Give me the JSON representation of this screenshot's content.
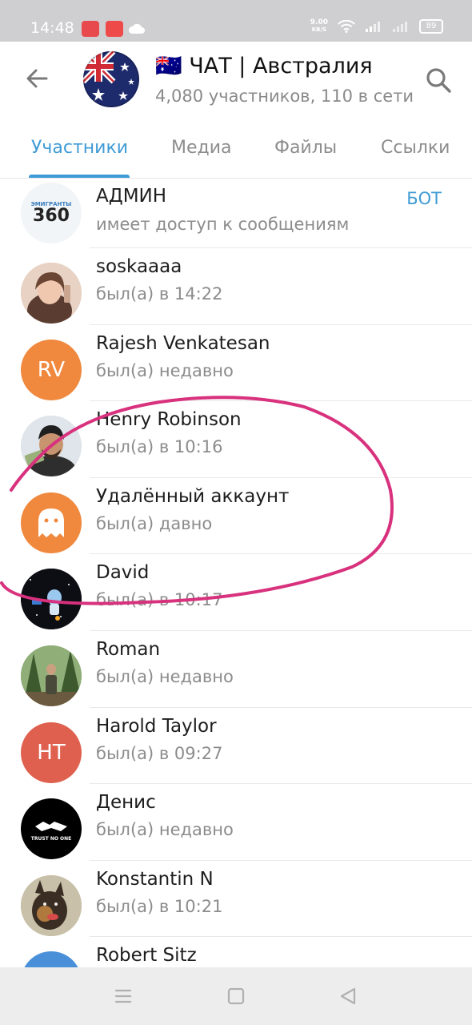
{
  "status_bar": {
    "time": "14:48",
    "speed_value": "9.00",
    "speed_unit": "KB/S",
    "battery": "89"
  },
  "header": {
    "flag": "🇦🇺",
    "title": "ЧАТ | Австралия",
    "subtitle": "4,080 участников, 110 в сети"
  },
  "tabs": [
    {
      "label": "Участники",
      "active": true
    },
    {
      "label": "Медиа",
      "active": false
    },
    {
      "label": "Файлы",
      "active": false
    },
    {
      "label": "Ссылки",
      "active": false
    }
  ],
  "admin_logo": {
    "line1": "ЭМИГРАНТЫ",
    "line2": "360"
  },
  "members": [
    {
      "name": "АДМИН",
      "status": "имеет доступ к сообщениям",
      "role": "БОТ",
      "avatar_type": "logo"
    },
    {
      "name": "soskaaaa",
      "status": "был(а) в 14:22",
      "avatar_type": "photo-woman"
    },
    {
      "name": "Rajesh Venkatesan",
      "status": "был(а) недавно",
      "initials": "RV",
      "avatar_color": "#f0883e",
      "avatar_type": "initials"
    },
    {
      "name": "Henry Robinson",
      "status": "был(а) в 10:16",
      "avatar_type": "photo-man"
    },
    {
      "name": "Удалённый аккаунт",
      "status": "был(а) давно",
      "avatar_color": "#f0883e",
      "avatar_type": "ghost-icon"
    },
    {
      "name": "David",
      "status": "был(а) в 10:17",
      "avatar_type": "photo-space"
    },
    {
      "name": "Roman",
      "status": "был(а) недавно",
      "avatar_type": "photo-forest"
    },
    {
      "name": "Harold Taylor",
      "status": "был(а) в 09:27",
      "initials": "HT",
      "avatar_color": "#e0604f",
      "avatar_type": "initials"
    },
    {
      "name": "Денис",
      "status": "был(а) недавно",
      "avatar_type": "photo-trust",
      "avatar_caption": "TRUST NO ONE"
    },
    {
      "name": "Konstantin N",
      "status": "был(а) в 10:21",
      "avatar_type": "photo-dog"
    },
    {
      "name": "Robert Sitz",
      "status": "",
      "avatar_color": "#4a90d9",
      "avatar_type": "partial"
    }
  ],
  "colors": {
    "accent": "#3f9bd5",
    "annotation": "#d8317d"
  }
}
